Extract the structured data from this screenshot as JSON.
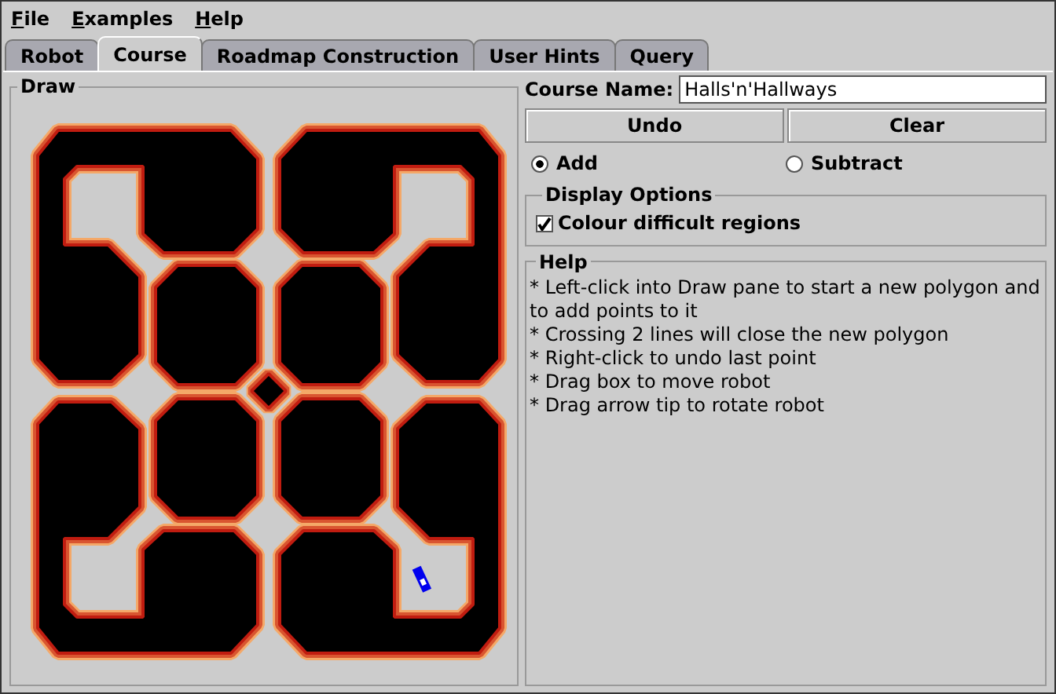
{
  "menu": [
    "File",
    "Examples",
    "Help"
  ],
  "tabs": [
    {
      "label": "Robot",
      "selected": false
    },
    {
      "label": "Course",
      "selected": true
    },
    {
      "label": "Roadmap Construction",
      "selected": false
    },
    {
      "label": "User Hints",
      "selected": false
    },
    {
      "label": "Query",
      "selected": false
    }
  ],
  "draw_panel": {
    "title": "Draw"
  },
  "course_name": {
    "label": "Course Name:",
    "value": "Halls'n'Hallways"
  },
  "buttons": [
    "Undo",
    "Clear"
  ],
  "modes": [
    {
      "label": "Add",
      "selected": true
    },
    {
      "label": "Subtract",
      "selected": false
    }
  ],
  "display_options": {
    "title": "Display Options",
    "checkbox": {
      "label": "Colour difficult regions",
      "checked": true
    }
  },
  "help": {
    "title": "Help",
    "lines": [
      "* Left-click into Draw pane to start a new polygon and to add points to it",
      "* Crossing 2 lines will close the new polygon",
      "* Right-click to undo last point",
      "* Drag box to move robot",
      "* Drag arrow tip to rotate robot"
    ]
  }
}
